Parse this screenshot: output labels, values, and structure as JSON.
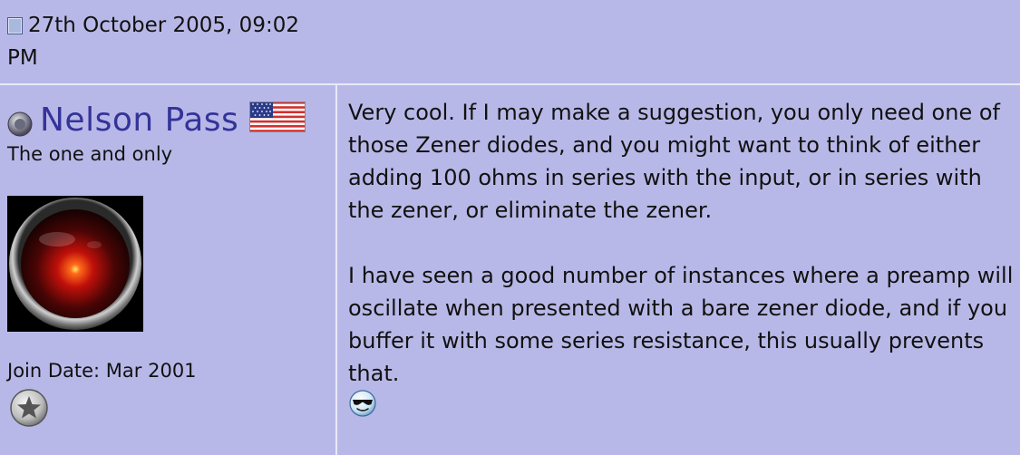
{
  "post": {
    "date": "27th October 2005, 09:02 PM",
    "icon": "document-icon"
  },
  "user": {
    "name": "Nelson Pass",
    "title": "The one and only",
    "join_date": "Join Date: Mar 2001",
    "status_icon": "offline-status-icon",
    "flag_icon": "us-flag-icon",
    "avatar_icon": "hal-9000-eye-avatar",
    "badge_icon": "star-badge-icon"
  },
  "message": {
    "paragraph1": "Very cool. If I may make a suggestion, you only need one of\nthose Zener diodes, and you might want to think of either\nadding 100 ohms in series with the input, or in series with\nthe zener, or eliminate the zener.",
    "paragraph2": "I have seen a good number of instances where a preamp will\noscillate when presented with a bare zener diode, and if you\nbuffer it with some series resistance, this usually prevents that.",
    "smiley_icon": "cool-sunglasses-smiley"
  },
  "colors": {
    "background": "#b8b8e8",
    "divider": "#e8e8fa",
    "username": "#333399",
    "text": "#111111"
  }
}
